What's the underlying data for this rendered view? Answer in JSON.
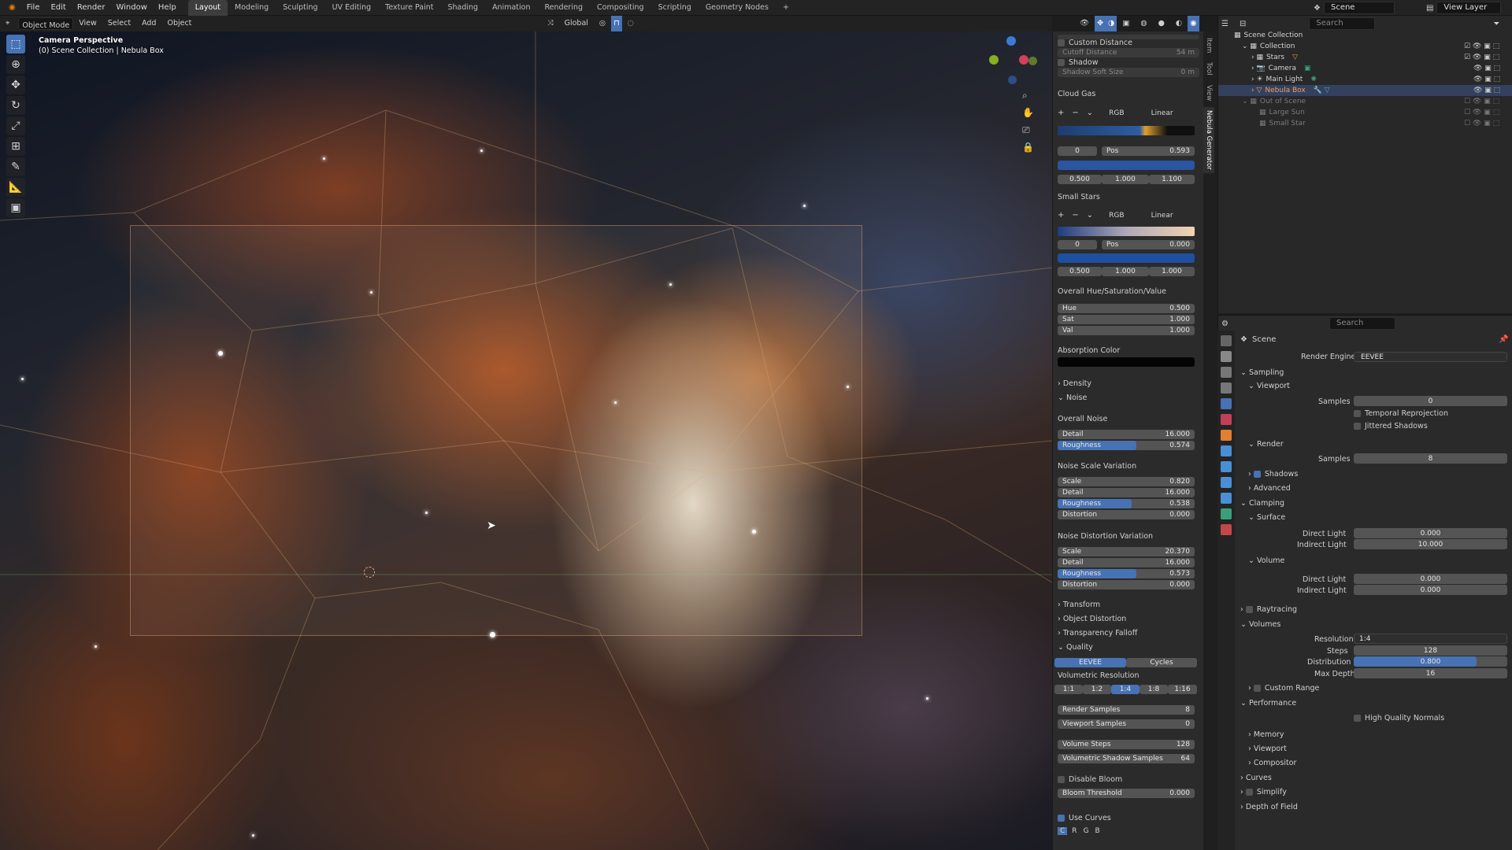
{
  "topbar": {
    "menus": [
      "File",
      "Edit",
      "Render",
      "Window",
      "Help"
    ],
    "workspaces": [
      "Layout",
      "Modeling",
      "Sculpting",
      "UV Editing",
      "Texture Paint",
      "Shading",
      "Animation",
      "Rendering",
      "Compositing",
      "Scripting",
      "Geometry Nodes"
    ],
    "active_workspace": "Layout",
    "add_workspace": "+",
    "scene": "Scene",
    "view_layer": "View Layer"
  },
  "viewport_header": {
    "mode": "Object Mode",
    "menus": [
      "View",
      "Select",
      "Add",
      "Object"
    ],
    "transform_orientation": "Global"
  },
  "viewport": {
    "title": "Camera Perspective",
    "subtitle": "(0) Scene Collection | Nebula Box"
  },
  "npanel": {
    "tabs": [
      "Item",
      "Tool",
      "View",
      "Nebula Generator"
    ],
    "custom_distance": "Custom Distance",
    "cutoff_distance": {
      "label": "Cutoff Distance",
      "value": "54 m"
    },
    "shadow": "Shadow",
    "shadow_soft_size": {
      "label": "Shadow Soft Size",
      "value": "0 m"
    },
    "cloud_gas": {
      "title": "Cloud Gas",
      "color_mode": "RGB",
      "interp": "Linear",
      "index": "0",
      "pos_label": "Pos",
      "pos": "0.593",
      "vals": [
        "0.500",
        "1.000",
        "1.100"
      ]
    },
    "small_stars": {
      "title": "Small Stars",
      "color_mode": "RGB",
      "interp": "Linear",
      "index": "0",
      "pos_label": "Pos",
      "pos": "0.000",
      "vals": [
        "0.500",
        "1.000",
        "1.000"
      ]
    },
    "hsv": {
      "title": "Overall Hue/Saturation/Value",
      "hue": {
        "label": "Hue",
        "value": "0.500"
      },
      "sat": {
        "label": "Sat",
        "value": "1.000"
      },
      "val": {
        "label": "Val",
        "value": "1.000"
      }
    },
    "absorption": "Absorption Color",
    "density": "Density",
    "noise": "Noise",
    "overall_noise": {
      "title": "Overall Noise",
      "detail": {
        "label": "Detail",
        "value": "16.000"
      },
      "roughness": {
        "label": "Roughness",
        "value": "0.574",
        "fraction": 0.574
      }
    },
    "noise_scale": {
      "title": "Noise Scale Variation",
      "scale": {
        "label": "Scale",
        "value": "0.820"
      },
      "detail": {
        "label": "Detail",
        "value": "16.000"
      },
      "roughness": {
        "label": "Roughness",
        "value": "0.538",
        "fraction": 0.538
      },
      "distortion": {
        "label": "Distortion",
        "value": "0.000"
      }
    },
    "noise_distortion": {
      "title": "Noise Distortion Variation",
      "scale": {
        "label": "Scale",
        "value": "20.370"
      },
      "detail": {
        "label": "Detail",
        "value": "16.000"
      },
      "roughness": {
        "label": "Roughness",
        "value": "0.573",
        "fraction": 0.573
      },
      "distortion": {
        "label": "Distortion",
        "value": "0.000"
      }
    },
    "transform": "Transform",
    "object_distortion": "Object Distortion",
    "transparency_falloff": "Transparency Falloff",
    "quality": "Quality",
    "engines": [
      "EEVEE",
      "Cycles"
    ],
    "vol_res_title": "Volumetric Resolution",
    "vol_res": [
      "1:1",
      "1:2",
      "1:4",
      "1:8",
      "1:16"
    ],
    "render_samples": {
      "label": "Render Samples",
      "value": "8"
    },
    "viewport_samples": {
      "label": "Viewport Samples",
      "value": "0"
    },
    "volume_steps": {
      "label": "Volume Steps",
      "value": "128"
    },
    "vol_shadow_samples": {
      "label": "Volumetric Shadow Samples",
      "value": "64"
    },
    "disable_bloom": "Disable Bloom",
    "bloom_threshold": {
      "label": "Bloom Threshold",
      "value": "0.000"
    },
    "use_curves": "Use Curves",
    "curve_channels": [
      "C",
      "R",
      "G",
      "B"
    ]
  },
  "outliner": {
    "search_placeholder": "Search",
    "items": [
      {
        "label": "Scene Collection",
        "indent": 0,
        "state": "normal"
      },
      {
        "label": "Collection",
        "indent": 1,
        "state": "normal"
      },
      {
        "label": "Stars",
        "indent": 2,
        "state": "normal"
      },
      {
        "label": "Camera",
        "indent": 2,
        "state": "normal"
      },
      {
        "label": "Main Light",
        "indent": 2,
        "state": "normal"
      },
      {
        "label": "Nebula Box",
        "indent": 2,
        "state": "selected"
      },
      {
        "label": "Out of Scene",
        "indent": 1,
        "state": "dim"
      },
      {
        "label": "Large Sun",
        "indent": 2,
        "state": "dim"
      },
      {
        "label": "Small Star",
        "indent": 2,
        "state": "dim"
      }
    ]
  },
  "properties": {
    "search_placeholder": "Search",
    "context": "Scene",
    "render_engine": {
      "label": "Render Engine",
      "value": "EEVEE"
    },
    "sampling": "Sampling",
    "viewport": "Viewport",
    "vp_samples": {
      "label": "Samples",
      "value": "0"
    },
    "temporal_reprojection": "Temporal Reprojection",
    "jittered_shadows": "Jittered Shadows",
    "render": "Render",
    "r_samples": {
      "label": "Samples",
      "value": "8"
    },
    "shadows": "Shadows",
    "advanced": "Advanced",
    "clamping": "Clamping",
    "surface": "Surface",
    "s_direct": {
      "label": "Direct Light",
      "value": "0.000"
    },
    "s_indirect": {
      "label": "Indirect Light",
      "value": "10.000"
    },
    "volume": "Volume",
    "v_direct": {
      "label": "Direct Light",
      "value": "0.000"
    },
    "v_indirect": {
      "label": "Indirect Light",
      "value": "0.000"
    },
    "raytracing": "Raytracing",
    "volumes": "Volumes",
    "resolution": {
      "label": "Resolution",
      "value": "1:4"
    },
    "steps": {
      "label": "Steps",
      "value": "128"
    },
    "distribution": {
      "label": "Distribution",
      "value": "0.800",
      "fraction": 0.8
    },
    "max_depth": {
      "label": "Max Depth",
      "value": "16"
    },
    "custom_range": "Custom Range",
    "performance": "Performance",
    "high_quality_normals": "High Quality Normals",
    "memory": "Memory",
    "perf_viewport": "Viewport",
    "compositor": "Compositor",
    "curves": "Curves",
    "simplify": "Simplify",
    "depth_of_field": "Depth of Field"
  },
  "colors": {
    "accent": "#4772b3",
    "selected_row": "#33415e"
  }
}
